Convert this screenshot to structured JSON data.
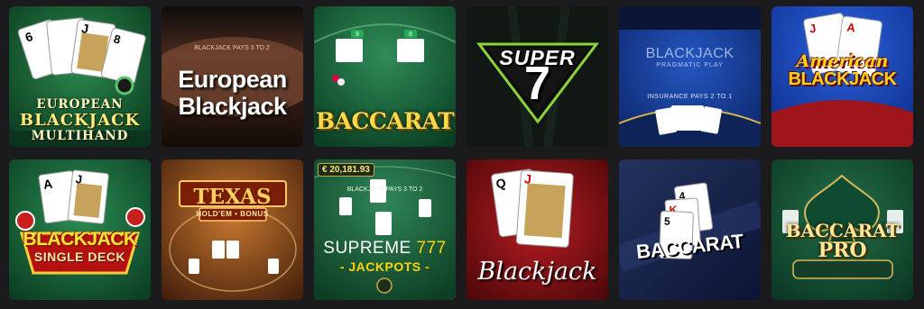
{
  "tiles": [
    {
      "id": "european-blackjack-multihand",
      "lines": [
        "EUROPEAN",
        "BLACKJACK",
        "MULTIHAND"
      ]
    },
    {
      "id": "european-blackjack",
      "lines": [
        "European",
        "Blackjack"
      ],
      "table_text": "BLACKJACK PAYS 3 TO 2"
    },
    {
      "id": "baccarat",
      "lines": [
        "BACCARAT"
      ],
      "card_values": [
        "9",
        "8"
      ]
    },
    {
      "id": "super-7",
      "lines": [
        "SUPER",
        "7"
      ]
    },
    {
      "id": "pragmatic-blackjack",
      "lines": [
        "BLACKJACK",
        "PRAGMATIC PLAY",
        "INSURANCE PAYS 2 TO 1"
      ]
    },
    {
      "id": "american-blackjack",
      "lines": [
        "American",
        "BLACKJACK"
      ]
    },
    {
      "id": "blackjack-single-deck",
      "lines": [
        "BLACKJACK",
        "SINGLE DECK"
      ]
    },
    {
      "id": "texas-holdem-bonus",
      "lines": [
        "TEXAS",
        "HOLD'EM • BONUS"
      ]
    },
    {
      "id": "supreme-777-jackpots",
      "balance": "€ 20,181.93",
      "lines": [
        "SUPREME",
        "777",
        "- JACKPOTS -"
      ],
      "table_text": "BLACKJACK PAYS 3 TO 2"
    },
    {
      "id": "blackjack",
      "lines": [
        "Blackjack"
      ]
    },
    {
      "id": "baccarat-2",
      "lines": [
        "BACCARAT"
      ]
    },
    {
      "id": "baccarat-pro",
      "lines": [
        "BACCARAT",
        "PRO"
      ]
    }
  ],
  "colors": {
    "page_bg": "#1b1b1d",
    "green_felt": "#0f5a32",
    "blue_felt": "#163b9a",
    "red_felt": "#8b1418",
    "gold": "#ffd21f"
  }
}
